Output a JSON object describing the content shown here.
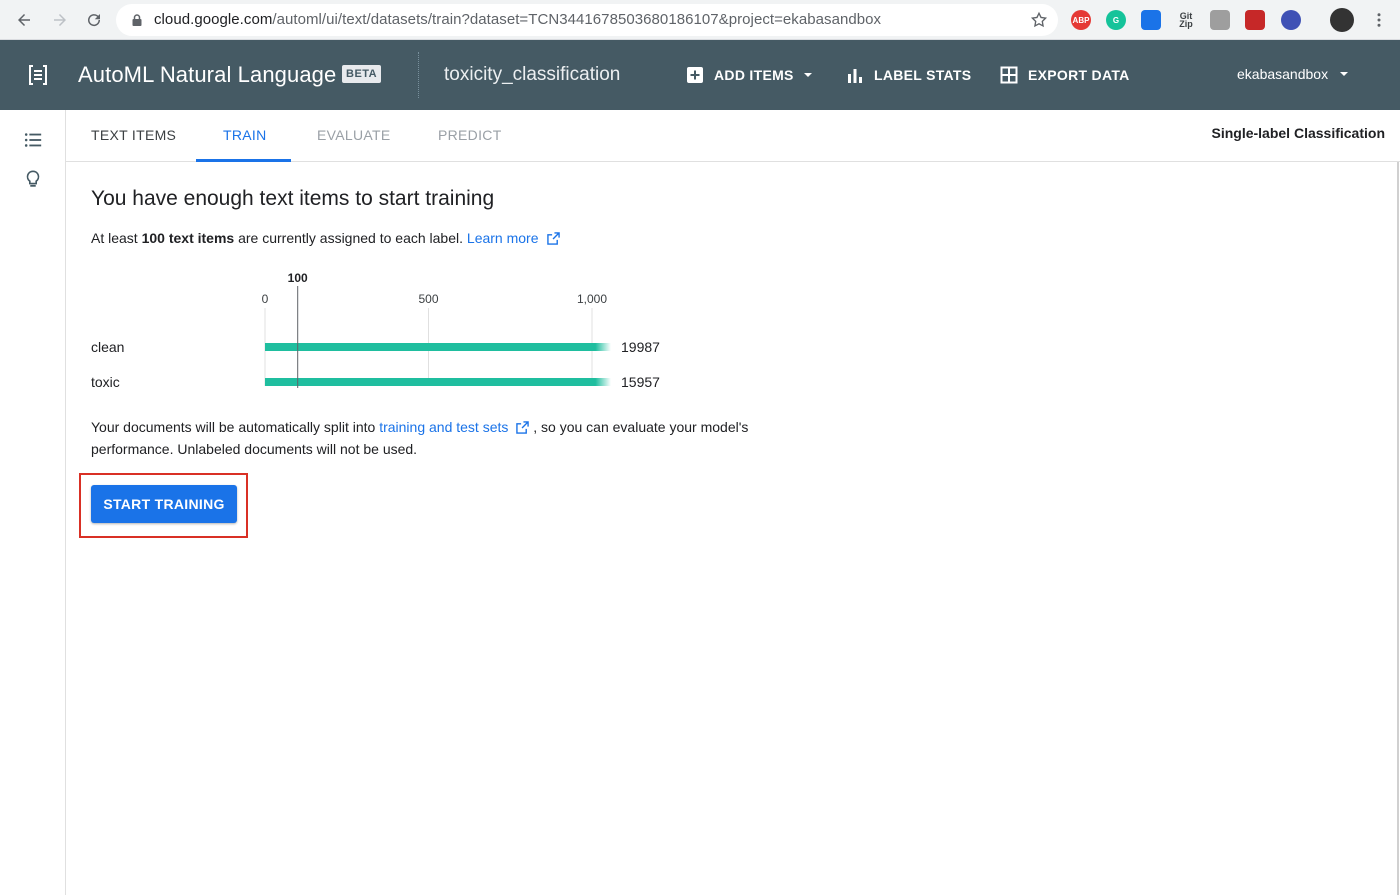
{
  "browser": {
    "url_host": "cloud.google.com",
    "url_path": "/automl/ui/text/datasets/train?dataset=TCN3441678503680186107&project=ekabasandbox",
    "extensions": [
      {
        "name": "adblock-plus-icon",
        "label": "ABP",
        "color": "#e53935"
      },
      {
        "name": "grammarly-icon",
        "label": "G",
        "color": "#15c39a"
      },
      {
        "name": "extension-icon",
        "label": "",
        "color": "#1a73e8"
      },
      {
        "name": "git-zip-icon",
        "label": "Git Zip",
        "color": "#5f6368"
      },
      {
        "name": "screenshot-icon",
        "label": "",
        "color": "#9e9e9e"
      },
      {
        "name": "extension-red-icon",
        "label": "",
        "color": "#c62828"
      },
      {
        "name": "extension-blue-icon",
        "label": "",
        "color": "#3f51b5"
      },
      {
        "name": "profile-avatar",
        "label": "",
        "color": "#333333"
      }
    ]
  },
  "header": {
    "product": "AutoML Natural Language",
    "badge": "BETA",
    "dataset": "toxicity_classification",
    "actions": {
      "add_items": "ADD ITEMS",
      "label_stats": "LABEL STATS",
      "export_data": "EXPORT DATA"
    },
    "account": "ekabasandbox"
  },
  "tabs": {
    "text_items": "TEXT ITEMS",
    "train": "TRAIN",
    "evaluate": "EVALUATE",
    "predict": "PREDICT"
  },
  "classification_type": "Single-label Classification",
  "main": {
    "heading": "You have enough text items to start training",
    "sub_prefix": "At least ",
    "sub_bold": "100 text items",
    "sub_suffix": " are currently assigned to each label.",
    "learn_more": "Learn more",
    "note_prefix": "Your documents will be automatically split into ",
    "note_link": "training and test sets",
    "note_suffix": " , so you can evaluate your model's performance. Unlabeled documents will not be used.",
    "start_button": "START TRAINING"
  },
  "chart_data": {
    "type": "bar",
    "orientation": "horizontal",
    "categories": [
      "clean",
      "toxic"
    ],
    "values": [
      19987,
      15957
    ],
    "xlim": [
      0,
      1000
    ],
    "ticks": [
      0,
      500,
      1000
    ],
    "tick_labels": [
      "0",
      "500",
      "1,000"
    ],
    "threshold": 100,
    "threshold_label": "100",
    "bar_color": "#1fbe9f",
    "value_labels": [
      "19987",
      "15957"
    ]
  },
  "colors": {
    "header_bg": "#455a64",
    "accent": "#1a73e8",
    "highlight_box": "#d93025"
  }
}
